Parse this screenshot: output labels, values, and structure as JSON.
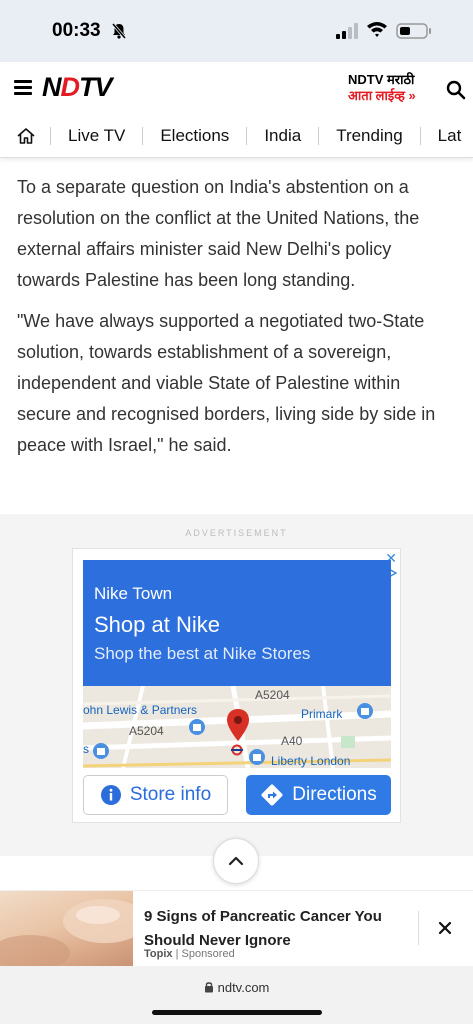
{
  "status_bar": {
    "time": "00:33"
  },
  "header": {
    "logo_prefix": "N",
    "logo_dot": "D",
    "logo_suffix": "TV",
    "promo_line1": "NDTV मराठी",
    "promo_line2": "आता लाईव्ह »"
  },
  "nav": {
    "items": [
      {
        "label": "Live TV"
      },
      {
        "label": "Elections"
      },
      {
        "label": "India"
      },
      {
        "label": "Trending"
      },
      {
        "label": "Lat"
      }
    ]
  },
  "article": {
    "paragraphs": [
      "To a separate question on India's abstention on a resolution on the conflict at the United Nations, the external affairs minister said New Delhi's policy towards Palestine has been long standing.",
      "\"We have always supported a negotiated two-State solution, towards establishment of a sovereign, independent and viable State of Palestine within secure and recognised borders, living side by side in peace with Israel,\" he said."
    ]
  },
  "ad": {
    "label": "ADVERTISEMENT",
    "store_name": "Nike Town",
    "headline": "Shop at Nike",
    "subline": "Shop the best at Nike Stores",
    "map_labels": {
      "a5204_top": "A5204",
      "john_lewis": "ohn Lewis & Partners",
      "a5204_left": "A5204",
      "primark": "Primark",
      "a40": "A40",
      "liberty": "Liberty London",
      "s": "s"
    },
    "store_info": "Store info",
    "directions": "Directions",
    "accent": "#2d6fdc"
  },
  "sponsored": {
    "title": "9 Signs of Pancreatic Cancer You Should Never Ignore",
    "source": "Topix",
    "tag": "| Sponsored"
  },
  "url_bar": {
    "domain": "ndtv.com"
  }
}
